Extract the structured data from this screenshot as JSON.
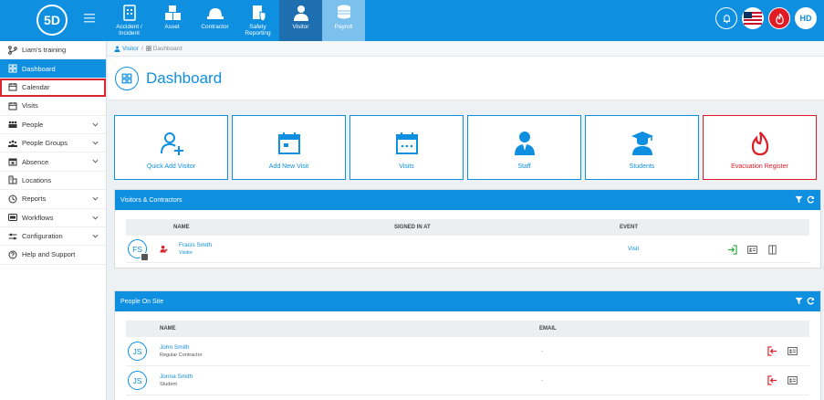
{
  "app": {
    "logo_text": "5D",
    "avatar_initials": "HD"
  },
  "modules": [
    {
      "label": "Accident / Incident",
      "icon": "first-aid-kit-icon"
    },
    {
      "label": "Asset",
      "icon": "boxes-icon"
    },
    {
      "label": "Contractor",
      "icon": "hard-hat-icon"
    },
    {
      "label": "Safety Reporting",
      "icon": "clipboard-shield-icon"
    },
    {
      "label": "Visitor",
      "icon": "person-icon"
    },
    {
      "label": "Payroll",
      "icon": "coins-icon"
    }
  ],
  "sidebar": {
    "items": [
      {
        "label": "Liam's training",
        "icon": "branch-icon"
      },
      {
        "label": "Dashboard",
        "icon": "dashboard-icon"
      },
      {
        "label": "Calendar",
        "icon": "calendar-icon"
      },
      {
        "label": "Visits",
        "icon": "calendar-icon"
      },
      {
        "label": "People",
        "icon": "people-icon"
      },
      {
        "label": "People Groups",
        "icon": "groups-icon"
      },
      {
        "label": "Absence",
        "icon": "absence-icon"
      },
      {
        "label": "Locations",
        "icon": "building-icon"
      },
      {
        "label": "Reports",
        "icon": "clock-icon"
      },
      {
        "label": "Workflows",
        "icon": "workflow-icon"
      },
      {
        "label": "Configuration",
        "icon": "config-icon"
      },
      {
        "label": "Help and Support",
        "icon": "help-icon"
      }
    ]
  },
  "breadcrumb": {
    "root": "Visitor",
    "sep": "/",
    "current": "Dashboard"
  },
  "page": {
    "title": "Dashboard"
  },
  "cards": [
    {
      "label": "Quick Add Visitor"
    },
    {
      "label": "Add New Visit"
    },
    {
      "label": "Visits"
    },
    {
      "label": "Staff"
    },
    {
      "label": "Students"
    },
    {
      "label": "Evacuation Register"
    }
  ],
  "visitors_panel": {
    "title": "Visitors & Contractors",
    "columns": [
      "NAME",
      "SIGNED IN AT",
      "EVENT"
    ],
    "rows": [
      {
        "initials": "FS",
        "name": "Fracis Smith",
        "type": "Visitor",
        "signed_in_at": "",
        "event": "Visit"
      }
    ]
  },
  "onsite_panel": {
    "title": "People On Site",
    "columns": [
      "NAME",
      "EMAIL"
    ],
    "rows": [
      {
        "initials": "JS",
        "name": "John Smith",
        "type": "Regular Contractor",
        "email": "-"
      },
      {
        "initials": "JS",
        "name": "Jonna Smith",
        "type": "Student",
        "email": "-"
      }
    ]
  },
  "colors": {
    "primary": "#0e8fe0",
    "danger": "#e01b24",
    "green": "#2cab3f"
  }
}
